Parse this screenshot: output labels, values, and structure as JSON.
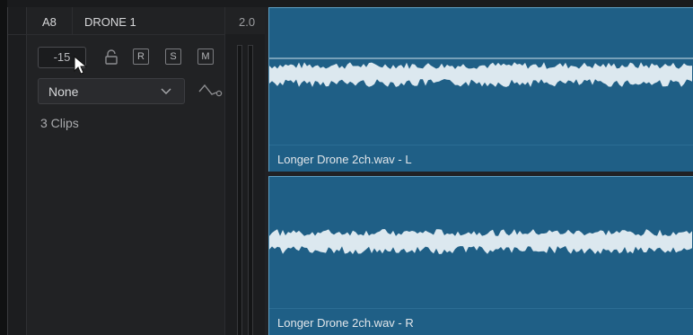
{
  "track": {
    "id": "A8",
    "name": "DRONE 1",
    "channel_format": "2.0",
    "volume": "-15",
    "buttons": [
      "R",
      "S",
      "M"
    ],
    "dropdown_value": "None",
    "clip_count": "3 Clips"
  },
  "clips": [
    {
      "label": "Longer Drone 2ch.wav - L"
    },
    {
      "label": "Longer Drone 2ch.wav - R"
    }
  ],
  "colors": {
    "clip_fill": "#1f5f86",
    "clip_border": "#5e9ec2",
    "waveform": "#dce8ef",
    "panel": "#212224"
  },
  "icons": [
    "lock-icon",
    "chevron-down-icon",
    "curve-icon",
    "mouse-cursor-icon"
  ]
}
